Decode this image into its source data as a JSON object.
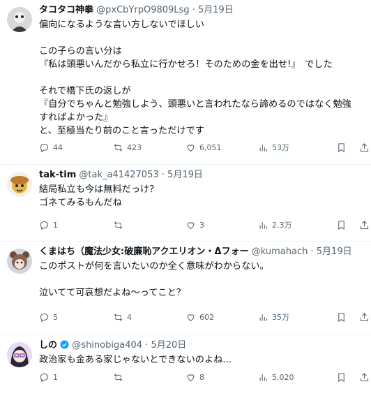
{
  "tweets": [
    {
      "name": "タコタコ神拳",
      "handle": "@pxCbYrpO9809Lsg",
      "date": "5月19日",
      "lines": [
        "偏向になるような言い方しないでほしい",
        "",
        "この子らの言い分は",
        "『私は頭悪いんだから私立に行かせろ！そのための金を出せ!』　でした",
        "",
        "それで橋下氏の返しが",
        "『自分でちゃんと勉強しよう、頭悪いと言われたなら諦めるのではなく勉強",
        "すればよかった』",
        "と、至極当たり前のこと言っただけです"
      ],
      "replies": "44",
      "retweets": "423",
      "likes": "6,051",
      "views": "53万"
    },
    {
      "name": "tak-tim",
      "handle": "@tak_a41427053",
      "date": "5月19日",
      "lines": [
        "結局私立も今は無料だっけ？",
        "ゴネてみるもんだね"
      ],
      "replies": "1",
      "retweets": "",
      "likes": "3",
      "views": "2.3万"
    },
    {
      "name": "くまはち（魔法少女:破廉恥アクエリオン・Δフォー",
      "handle": "@kumahach",
      "date": "5月19日",
      "lines": [
        "このポストが何を言いたいのか全く意味がわからない。",
        "",
        "泣いてて可哀想だよね〜ってこと？"
      ],
      "replies": "5",
      "retweets": "4",
      "likes": "602",
      "views": "35万"
    },
    {
      "name": "しの",
      "handle": "@shinobiga404",
      "date": "5月20日",
      "lines": [
        "政治家も金ある家じゃないとできないのよね..."
      ],
      "replies": "1",
      "retweets": "",
      "likes": "8",
      "views": "5,020"
    }
  ],
  "icons": [
    "reply-icon",
    "retweet-icon",
    "like-icon",
    "views-icon",
    "bookmark-icon",
    "share-icon",
    "verified-icon"
  ],
  "colors": {
    "text": "#0f1419",
    "secondary": "#536471",
    "divider": "#eff3f4",
    "verified": "#1d9bf0"
  }
}
